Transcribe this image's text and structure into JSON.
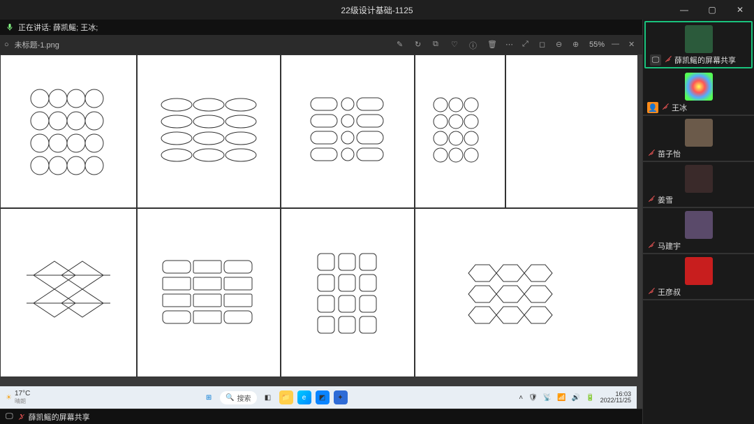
{
  "window": {
    "title": "22级设计基础-1125",
    "min": "—",
    "max": "▢",
    "close": "✕"
  },
  "speaking": {
    "label": "正在讲话: 薛凯鳐; 王冰;"
  },
  "viewer": {
    "tab_icon": "○",
    "filename": "未标题-1.png",
    "zoom": "55%",
    "tools": {
      "edit": "✎",
      "rotate": "↻",
      "crop": "⧉",
      "heart": "♡",
      "info": "ⓘ",
      "delete": "🗑",
      "more": "⋯"
    },
    "right_tools": {
      "expand": "⤢",
      "fit": "◻",
      "zoom_out": "⊖",
      "zoom_in": "⊕",
      "px": "—",
      "close": "✕"
    }
  },
  "panel": {
    "items": [
      {
        "name": "薛凯鳐的屏幕共享",
        "mic_muted": true,
        "shared": true,
        "avatar_color": "#2b5a3b"
      },
      {
        "name": "王冰",
        "mic_muted": true,
        "host": true,
        "avatar_color": "radial"
      },
      {
        "name": "苗子怡",
        "mic_muted": true,
        "avatar_color": "#6b5a4a"
      },
      {
        "name": "姜雪",
        "mic_muted": true,
        "avatar_color": "#3a2a2a"
      },
      {
        "name": "马建宇",
        "mic_muted": true,
        "avatar_color": "#5a4a6a"
      },
      {
        "name": "王彦叔",
        "mic_muted": true,
        "avatar_color": "#c81e1e"
      }
    ]
  },
  "status": {
    "label": "薛凯鳐的屏幕共享"
  },
  "taskbar": {
    "temp": "17°C",
    "temp_sub": "晴朗",
    "search": "搜索",
    "time": "16:03",
    "date": "2022/11/25"
  }
}
